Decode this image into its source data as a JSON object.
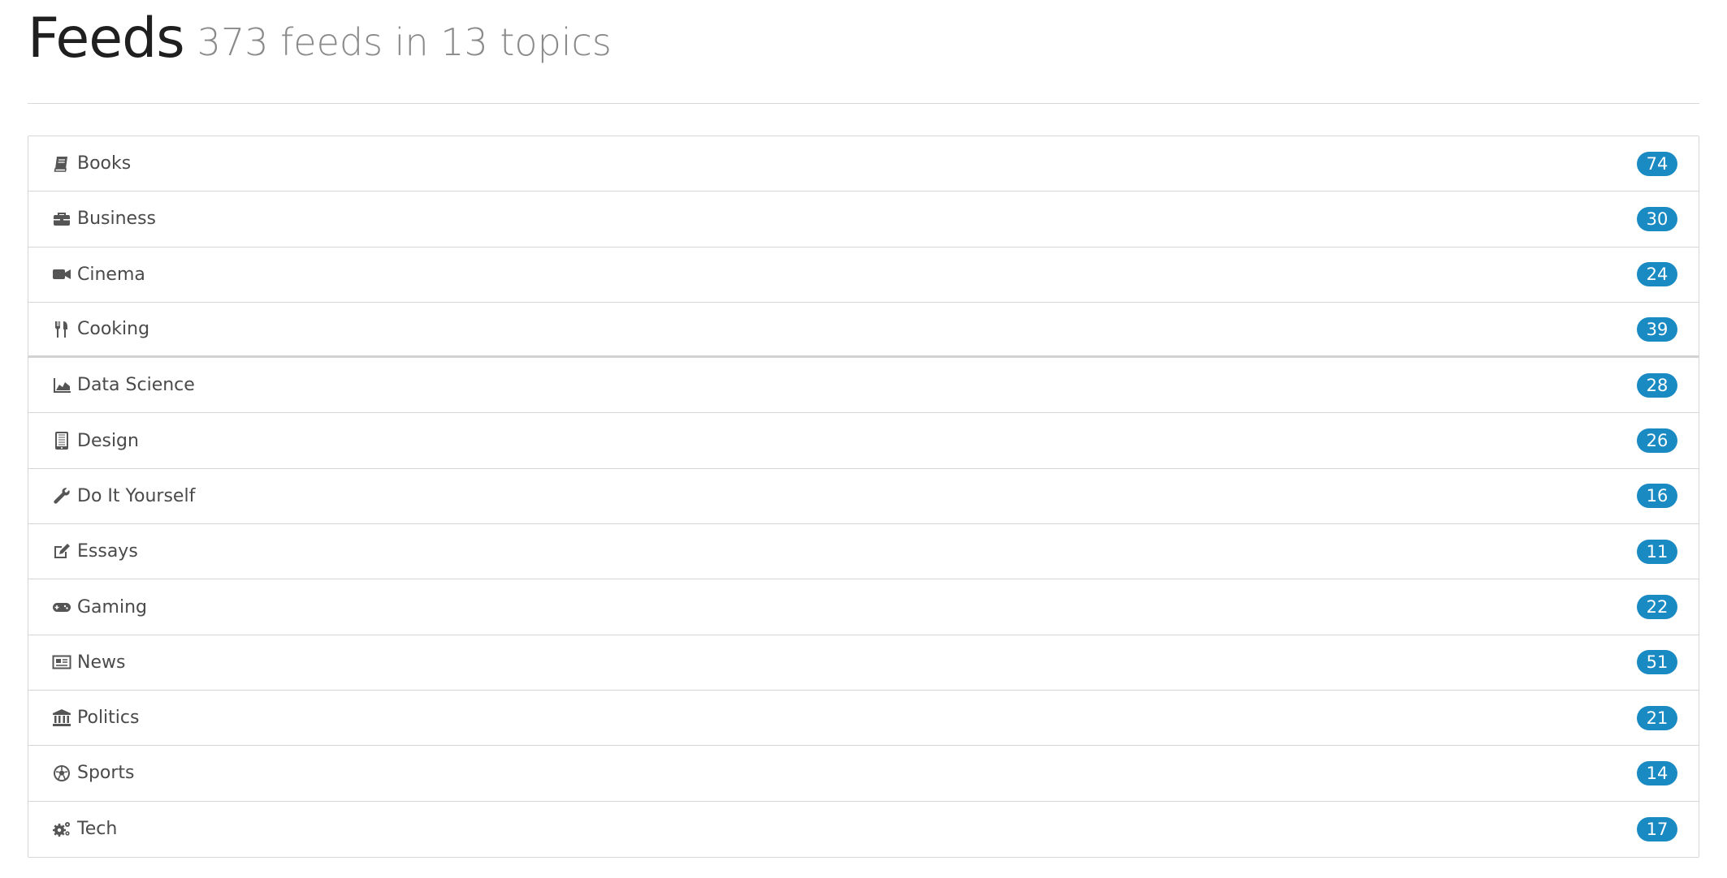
{
  "header": {
    "title": "Feeds",
    "subtitle": "373 feeds in 13 topics"
  },
  "topics": [
    {
      "label": "Books",
      "count": "74",
      "icon": "book-icon"
    },
    {
      "label": "Business",
      "count": "30",
      "icon": "briefcase-icon"
    },
    {
      "label": "Cinema",
      "count": "24",
      "icon": "video-camera-icon"
    },
    {
      "label": "Cooking",
      "count": "39",
      "icon": "cutlery-icon"
    },
    {
      "label": "Data Science",
      "count": "28",
      "icon": "area-chart-icon"
    },
    {
      "label": "Design",
      "count": "26",
      "icon": "tablet-icon"
    },
    {
      "label": "Do It Yourself",
      "count": "16",
      "icon": "wrench-icon"
    },
    {
      "label": "Essays",
      "count": "11",
      "icon": "edit-icon"
    },
    {
      "label": "Gaming",
      "count": "22",
      "icon": "gamepad-icon"
    },
    {
      "label": "News",
      "count": "51",
      "icon": "newspaper-icon"
    },
    {
      "label": "Politics",
      "count": "21",
      "icon": "institution-icon"
    },
    {
      "label": "Sports",
      "count": "14",
      "icon": "soccer-ball-icon"
    },
    {
      "label": "Tech",
      "count": "17",
      "icon": "cogs-icon"
    }
  ],
  "colors": {
    "badge": "#1a8ac3",
    "border": "#d6d6d6",
    "text": "#4a4a4a",
    "subtitle": "#8a8a8a"
  }
}
